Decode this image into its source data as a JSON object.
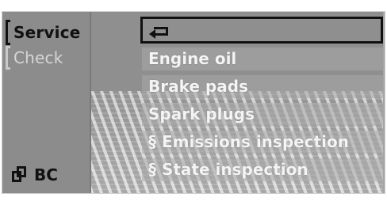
{
  "sidebar": {
    "items": [
      {
        "label": "Service"
      },
      {
        "label": "Check"
      }
    ],
    "bottom": {
      "icon": "dual-window-icon",
      "label": "BC"
    }
  },
  "menu": {
    "back": {
      "icon": "back-arrow-icon"
    },
    "items": [
      {
        "label": "Engine oil"
      },
      {
        "label": "Brake pads"
      },
      {
        "label": "Spark plugs"
      },
      {
        "label": "§ Emissions inspection"
      },
      {
        "label": "§ State inspection"
      }
    ]
  },
  "colors": {
    "background": "#8f8f8f",
    "text_active": "#111111",
    "text_inactive": "#d6d6d6",
    "text_menu": "#f4f4f4"
  }
}
